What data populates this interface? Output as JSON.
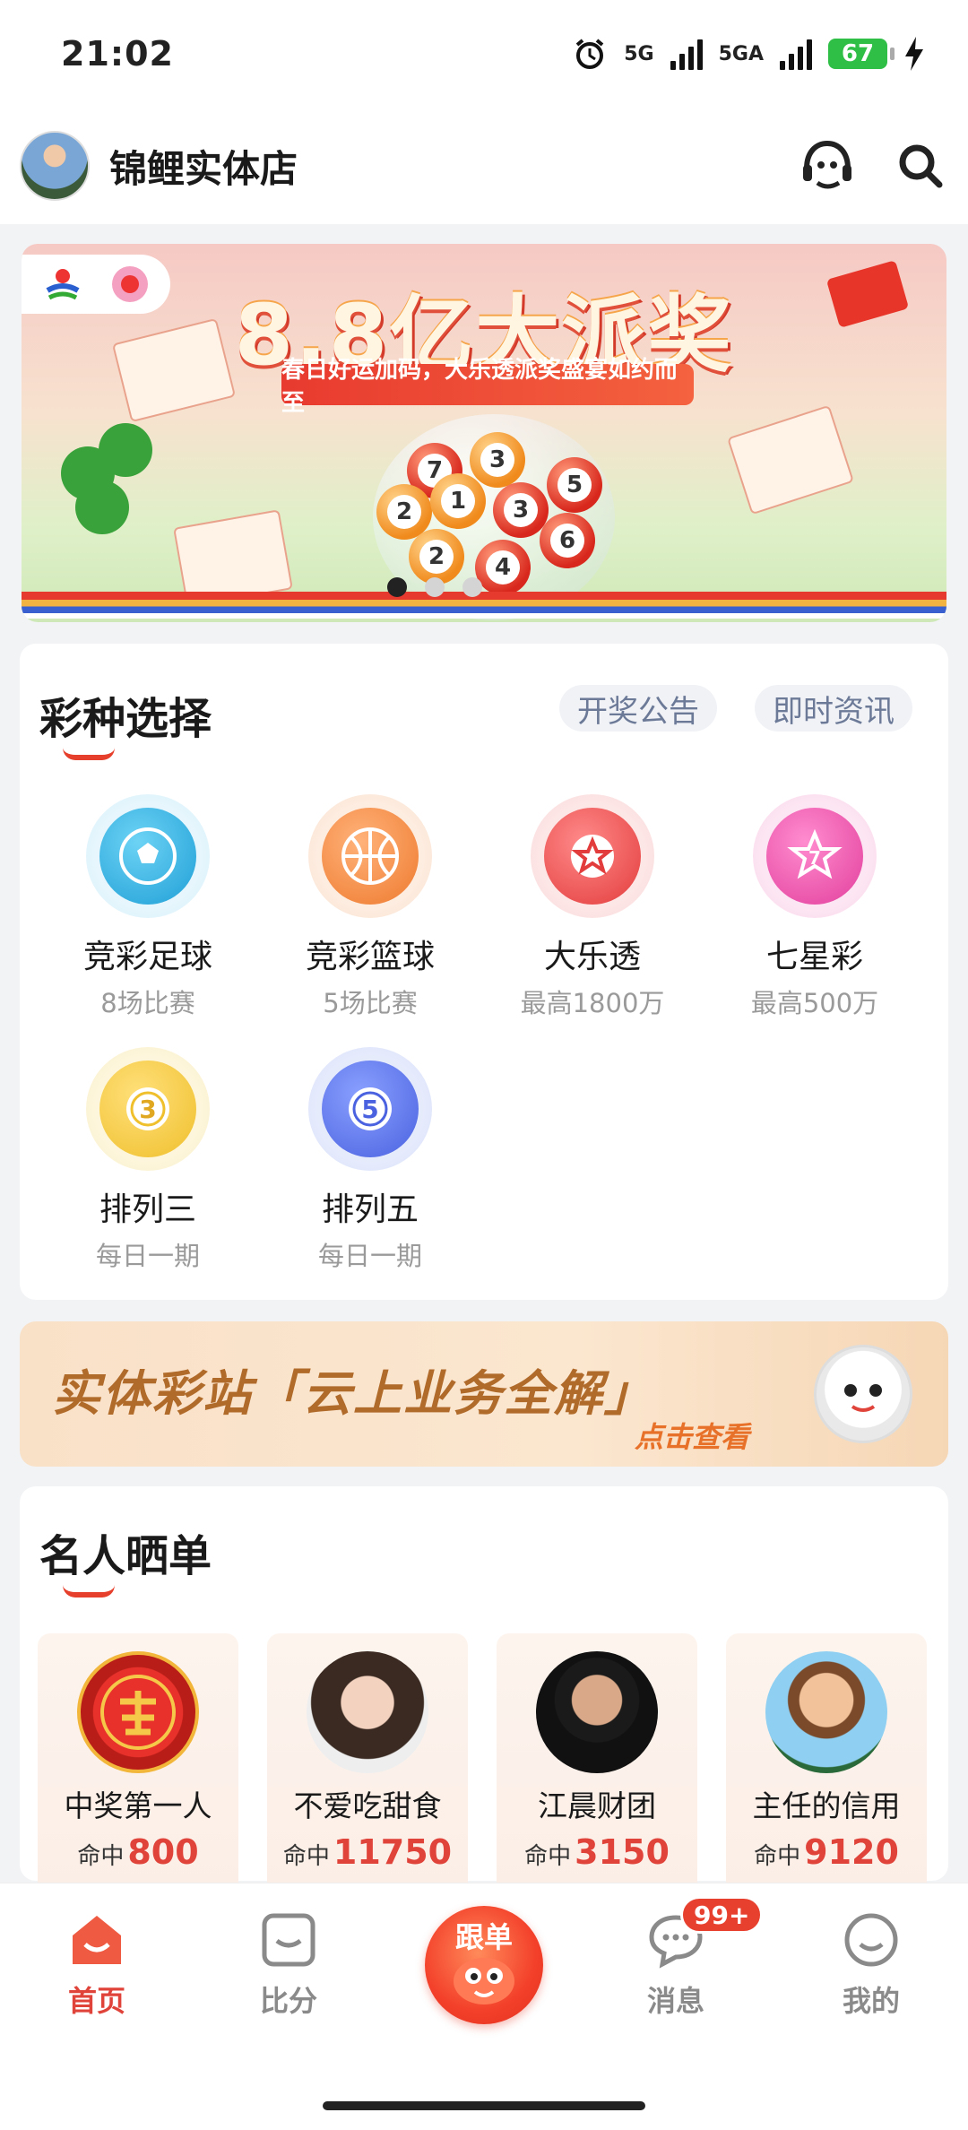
{
  "status_bar": {
    "time": "21:02",
    "battery": "67",
    "network_1": "5G",
    "network_2": "5GA"
  },
  "header": {
    "store_name": "锦鲤实体店",
    "icons": [
      "customer-service-icon",
      "search-icon"
    ]
  },
  "banner": {
    "title": "8.8亿大派奖",
    "subtitle": "春日好运加码，大乐透派奖盛宴如约而至",
    "balls": [
      "7",
      "3",
      "2",
      "1",
      "3",
      "5",
      "2",
      "4",
      "6"
    ],
    "slides": 3,
    "active_slide": 1
  },
  "lottery": {
    "title": "彩种选择",
    "links": [
      "开奖公告",
      "即时资讯"
    ],
    "games": [
      {
        "name": "竞彩足球",
        "sub": "8场比赛",
        "icon": "football-icon",
        "color": "#2fa8dc"
      },
      {
        "name": "竞彩篮球",
        "sub": "5场比赛",
        "icon": "basketball-icon",
        "color": "#f08a3a"
      },
      {
        "name": "大乐透",
        "sub": "最高1800万",
        "icon": "star-ball-icon",
        "color": "#ec4b4b"
      },
      {
        "name": "七星彩",
        "sub": "最高500万",
        "icon": "seven-star-icon",
        "color": "#ea4aa6"
      },
      {
        "name": "排列三",
        "sub": "每日一期",
        "icon": "number-three-icon",
        "color": "#f0c23a"
      },
      {
        "name": "排列五",
        "sub": "每日一期",
        "icon": "number-five-icon",
        "color": "#4f6be6"
      }
    ]
  },
  "promo": {
    "title": "实体彩站「云上业务全解」",
    "link": "点击查看"
  },
  "celebrities": {
    "title": "名人晒单",
    "hit_label": "命中",
    "items": [
      {
        "name": "中奖第一人",
        "hits": "800",
        "avatar": "prize-badge-avatar"
      },
      {
        "name": "不爱吃甜食",
        "hits": "11750",
        "avatar": "girl-avatar"
      },
      {
        "name": "江晨财团",
        "hits": "3150",
        "avatar": "man-avatar"
      },
      {
        "name": "主任的信用",
        "hits": "9120",
        "avatar": "cartoon-player-avatar"
      }
    ]
  },
  "bottom_nav": {
    "items": [
      {
        "label": "首页",
        "icon": "home-icon",
        "active": true
      },
      {
        "label": "比分",
        "icon": "score-icon",
        "active": false
      },
      {
        "label": "跟单",
        "icon": "follow-icon",
        "active": false
      },
      {
        "label": "消息",
        "icon": "message-icon",
        "active": false,
        "badge": "99+"
      },
      {
        "label": "我的",
        "icon": "profile-icon",
        "active": false
      }
    ]
  }
}
